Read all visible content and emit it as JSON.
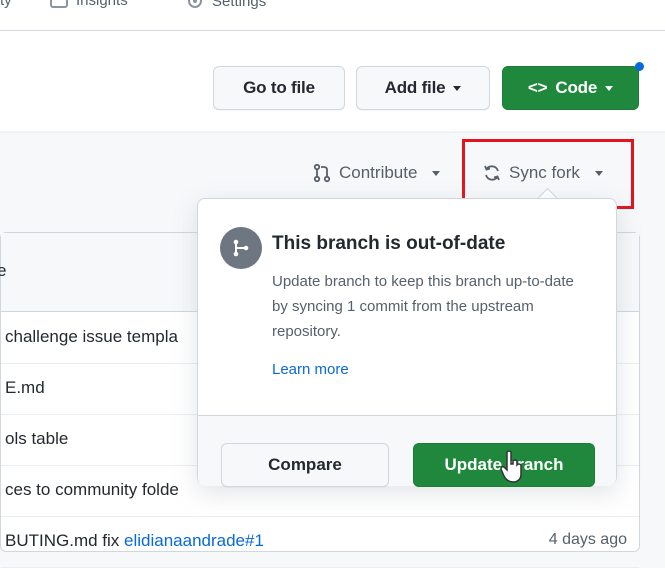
{
  "topnav": {
    "items": [
      {
        "label": "ty",
        "icon": "none"
      },
      {
        "label": "Insights",
        "icon": "graph-icon"
      },
      {
        "label": "Settings",
        "icon": "gear-icon"
      }
    ]
  },
  "header": {
    "go_to_file": "Go to file",
    "add_file": "Add file",
    "code": "Code",
    "code_icon": "<>"
  },
  "subbar": {
    "contribute": "Contribute",
    "sync_fork": "Sync fork"
  },
  "popup": {
    "title": "This branch is out-of-date",
    "description": "Update branch to keep this branch up-to-date by syncing 1 commit from the upstream repository.",
    "learn_more": "Learn more",
    "compare": "Compare",
    "update_branch": "Update branch"
  },
  "files": {
    "header_fragment": "e",
    "rows": [
      {
        "text": " challenge issue templa",
        "link": "",
        "date": ""
      },
      {
        "text": "E.md",
        "link": "",
        "date": ""
      },
      {
        "text": "ols table",
        "link": "",
        "date": ""
      },
      {
        "text": "ces to community folde",
        "link": "",
        "date": ""
      },
      {
        "text": "BUTING.md fix ",
        "link": "elidianaandrade#1",
        "date": "4 days ago"
      }
    ]
  },
  "colors": {
    "primary_green": "#1f883d",
    "link_blue": "#0969da",
    "highlight_red": "#e5131d"
  }
}
